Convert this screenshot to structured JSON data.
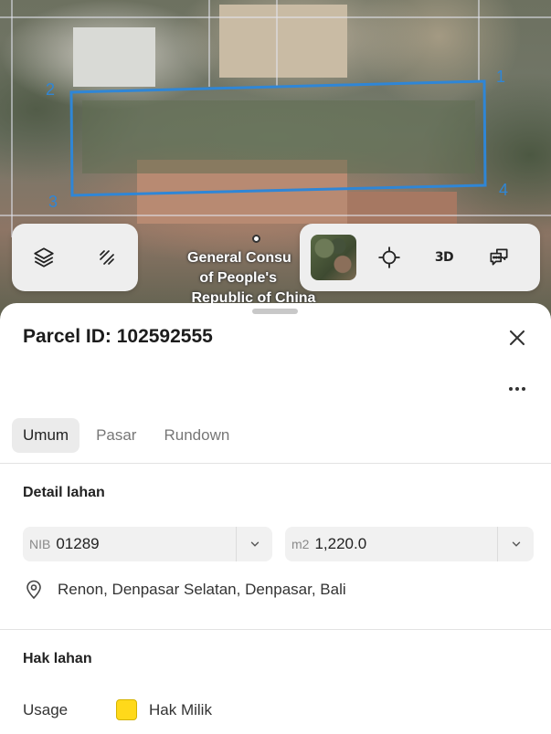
{
  "map": {
    "label": "General Consu\n   of People's\n Republic of China",
    "vertices": [
      "1",
      "2",
      "3",
      "4"
    ],
    "parcel_outline_color": "#2f86d6"
  },
  "controls": {
    "left": [
      {
        "icon": "layers-icon"
      },
      {
        "icon": "ruler-icon"
      }
    ],
    "right": {
      "basemap_icon": "satellite-thumbnail",
      "locate_icon": "crosshair-icon",
      "three_d_label": "3D",
      "chat_icon": "chat-bubble-icon"
    }
  },
  "sheet": {
    "title": "Parcel ID: 102592555",
    "tabs": [
      {
        "label": "Umum",
        "active": true
      },
      {
        "label": "Pasar",
        "active": false
      },
      {
        "label": "Rundown",
        "active": false
      }
    ],
    "detail": {
      "title": "Detail lahan",
      "nib_prefix": "NIB",
      "nib_value": "01289",
      "area_prefix": "m2",
      "area_value": "1,220.0",
      "address": "Renon, Denpasar Selatan, Denpasar, Bali"
    },
    "rights": {
      "title": "Hak lahan",
      "usage_label": "Usage",
      "usage_value": "Hak Milik",
      "usage_color": "#ffd91a"
    }
  }
}
